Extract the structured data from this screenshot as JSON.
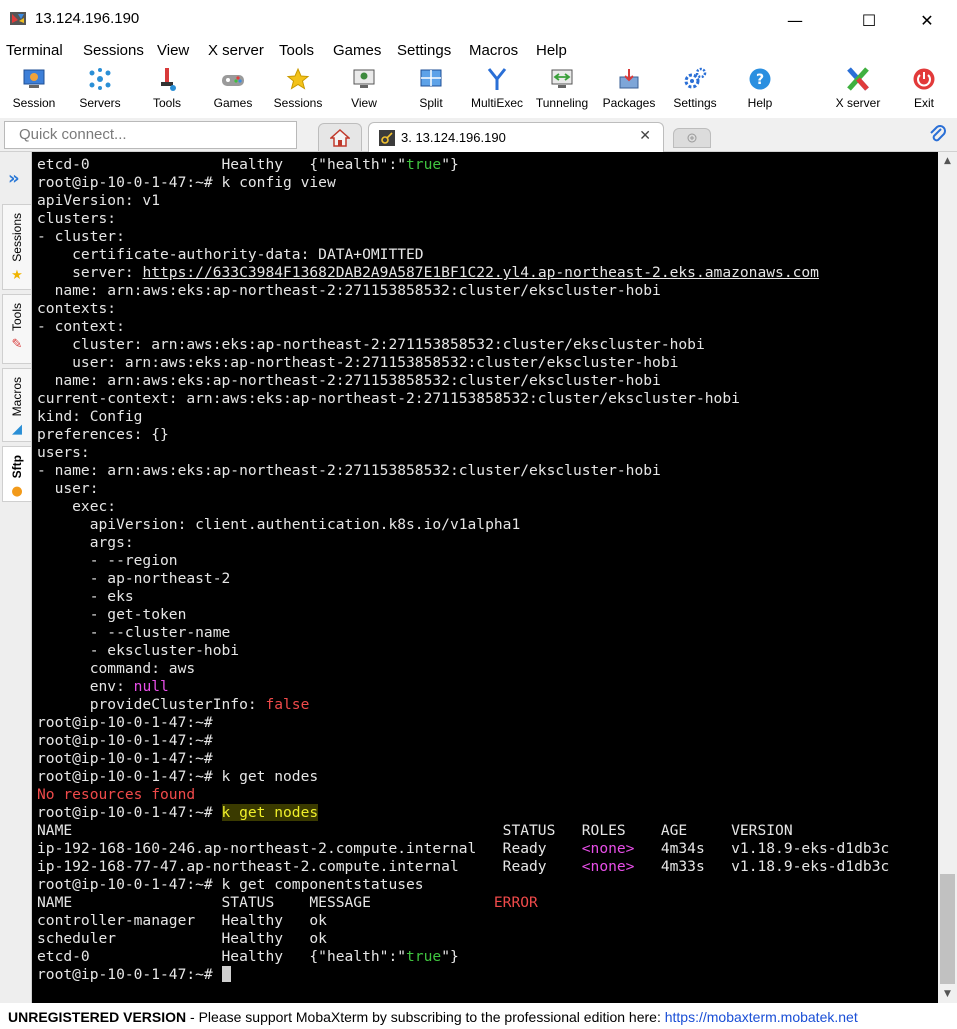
{
  "window": {
    "title": "13.124.196.190",
    "minimize": "—",
    "maximize": "☐",
    "close": "✕"
  },
  "menu": [
    "Terminal",
    "Sessions",
    "View",
    "X server",
    "Tools",
    "Games",
    "Settings",
    "Macros",
    "Help"
  ],
  "toolbar": [
    {
      "label": "Session",
      "icon": "session-icon"
    },
    {
      "label": "Servers",
      "icon": "servers-icon"
    },
    {
      "label": "Tools",
      "icon": "tools-icon"
    },
    {
      "label": "Games",
      "icon": "games-icon"
    },
    {
      "label": "Sessions",
      "icon": "sessions-star-icon"
    },
    {
      "label": "View",
      "icon": "view-icon"
    },
    {
      "label": "Split",
      "icon": "split-icon"
    },
    {
      "label": "MultiExec",
      "icon": "multiexec-icon"
    },
    {
      "label": "Tunneling",
      "icon": "tunneling-icon"
    },
    {
      "label": "Packages",
      "icon": "packages-icon"
    },
    {
      "label": "Settings",
      "icon": "settings-icon"
    },
    {
      "label": "Help",
      "icon": "help-icon"
    },
    {
      "label": "X server",
      "icon": "xserver-icon"
    },
    {
      "label": "Exit",
      "icon": "exit-icon"
    }
  ],
  "tabs": {
    "quick_connect_placeholder": "Quick connect...",
    "session_title": "3. 13.124.196.190",
    "close_glyph": "✕"
  },
  "sidebar": {
    "tabs": [
      "Sessions",
      "Tools",
      "Macros",
      "Sftp"
    ]
  },
  "terminal": {
    "lines": [
      [
        {
          "t": "etcd-0               Healthy   {\"health\":\""
        },
        {
          "t": "true",
          "c": "green"
        },
        {
          "t": "\"}"
        }
      ],
      [
        {
          "t": "root@ip-10-0-1-47:~# k config view"
        }
      ],
      [
        {
          "t": "apiVersion: v1"
        }
      ],
      [
        {
          "t": "clusters:"
        }
      ],
      [
        {
          "t": "- cluster:"
        }
      ],
      [
        {
          "t": "    certificate-authority-data: DATA+OMITTED"
        }
      ],
      [
        {
          "t": "    server: "
        },
        {
          "t": "https://633C3984F13682DAB2A9A587E1BF1C22.yl4.ap-northeast-2.eks.amazonaws.com",
          "c": "url"
        }
      ],
      [
        {
          "t": "  name: arn:aws:eks:ap-northeast-2:271153858532:cluster/ekscluster-hobi"
        }
      ],
      [
        {
          "t": "contexts:"
        }
      ],
      [
        {
          "t": "- context:"
        }
      ],
      [
        {
          "t": "    cluster: arn:aws:eks:ap-northeast-2:271153858532:cluster/ekscluster-hobi"
        }
      ],
      [
        {
          "t": "    user: arn:aws:eks:ap-northeast-2:271153858532:cluster/ekscluster-hobi"
        }
      ],
      [
        {
          "t": "  name: arn:aws:eks:ap-northeast-2:271153858532:cluster/ekscluster-hobi"
        }
      ],
      [
        {
          "t": "current-context: arn:aws:eks:ap-northeast-2:271153858532:cluster/ekscluster-hobi"
        }
      ],
      [
        {
          "t": "kind: Config"
        }
      ],
      [
        {
          "t": "preferences: {}"
        }
      ],
      [
        {
          "t": "users:"
        }
      ],
      [
        {
          "t": "- name: arn:aws:eks:ap-northeast-2:271153858532:cluster/ekscluster-hobi"
        }
      ],
      [
        {
          "t": "  user:"
        }
      ],
      [
        {
          "t": "    exec:"
        }
      ],
      [
        {
          "t": "      apiVersion: client.authentication.k8s.io/v1alpha1"
        }
      ],
      [
        {
          "t": "      args:"
        }
      ],
      [
        {
          "t": "      - --region"
        }
      ],
      [
        {
          "t": "      - ap-northeast-2"
        }
      ],
      [
        {
          "t": "      - eks"
        }
      ],
      [
        {
          "t": "      - get-token"
        }
      ],
      [
        {
          "t": "      - --cluster-name"
        }
      ],
      [
        {
          "t": "      - ekscluster-hobi"
        }
      ],
      [
        {
          "t": "      command: aws"
        }
      ],
      [
        {
          "t": "      env: "
        },
        {
          "t": "null",
          "c": "magenta"
        }
      ],
      [
        {
          "t": "      provideClusterInfo: "
        },
        {
          "t": "false",
          "c": "red"
        }
      ],
      [
        {
          "t": "root@ip-10-0-1-47:~#"
        }
      ],
      [
        {
          "t": "root@ip-10-0-1-47:~#"
        }
      ],
      [
        {
          "t": "root@ip-10-0-1-47:~#"
        }
      ],
      [
        {
          "t": "root@ip-10-0-1-47:~# k get nodes"
        }
      ],
      [
        {
          "t": "No resources found",
          "c": "red"
        }
      ],
      [
        {
          "t": "root@ip-10-0-1-47:~# "
        },
        {
          "t": "k get nodes",
          "c": "hl"
        }
      ],
      [
        {
          "t": "NAME                                                 STATUS   ROLES    AGE     VERSION"
        }
      ],
      [
        {
          "t": "ip-192-168-160-246.ap-northeast-2.compute.internal   Ready    "
        },
        {
          "t": "<none>",
          "c": "magenta"
        },
        {
          "t": "   4m34s   v1.18.9-eks-d1db3c"
        }
      ],
      [
        {
          "t": "ip-192-168-77-47.ap-northeast-2.compute.internal     Ready    "
        },
        {
          "t": "<none>",
          "c": "magenta"
        },
        {
          "t": "   4m33s   v1.18.9-eks-d1db3c"
        }
      ],
      [
        {
          "t": "root@ip-10-0-1-47:~# k get componentstatuses"
        }
      ],
      [
        {
          "t": "NAME                 STATUS    MESSAGE              "
        },
        {
          "t": "ERROR",
          "c": "red"
        }
      ],
      [
        {
          "t": "controller-manager   Healthy   ok"
        }
      ],
      [
        {
          "t": "scheduler            Healthy   ok"
        }
      ],
      [
        {
          "t": "etcd-0               Healthy   {\"health\":\""
        },
        {
          "t": "true",
          "c": "green"
        },
        {
          "t": "\"}"
        }
      ],
      [
        {
          "t": "root@ip-10-0-1-47:~# "
        },
        {
          "t": "",
          "c": "cursor"
        }
      ]
    ]
  },
  "status": {
    "unregistered": "UNREGISTERED VERSION",
    "message": "  -  Please support MobaXterm by subscribing to the professional edition here: ",
    "link": "https://mobaxterm.mobatek.net"
  },
  "colors": {
    "terminal_bg": "#000000",
    "terminal_fg": "#e6e6e6",
    "green": "#3fc43f",
    "magenta": "#e84ee8",
    "red": "#ef4a4a",
    "highlight": "#f0f02a",
    "link": "#1a4fd6"
  }
}
